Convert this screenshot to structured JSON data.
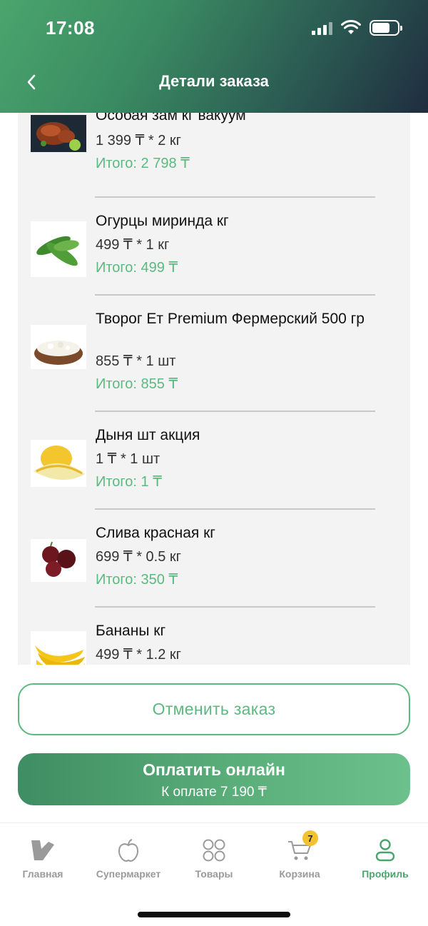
{
  "status_bar": {
    "time": "17:08"
  },
  "header": {
    "title": "Детали заказа"
  },
  "order_items": [
    {
      "name": "Особая зам кг вакуум",
      "qty": "1 399 ₸ * 2 кг",
      "total": "Итого:  2 798 ₸",
      "image": "grilled-chicken"
    },
    {
      "name": "Огурцы миринда кг",
      "qty": "499 ₸ * 1 кг",
      "total": "Итого:  499 ₸",
      "image": "cucumbers"
    },
    {
      "name": "Творог Ет Premium Фермерский 500 гр",
      "qty": "855 ₸ * 1 шт",
      "total": "Итого:  855 ₸",
      "image": "cottage-cheese"
    },
    {
      "name": "Дыня шт акция",
      "qty": "1 ₸ * 1 шт",
      "total": "Итого:  1 ₸",
      "image": "melon"
    },
    {
      "name": "Слива красная кг",
      "qty": "699 ₸ * 0.5 кг",
      "total": "Итого:  350 ₸",
      "image": "plums"
    },
    {
      "name": "Бананы кг",
      "qty": "499 ₸ * 1.2 кг",
      "image": "bananas"
    }
  ],
  "actions": {
    "cancel_label": "Отменить заказ",
    "pay_label": "Оплатить онлайн",
    "pay_amount": "К оплате 7 190 ₸"
  },
  "bottom_nav": {
    "items": [
      {
        "label": "Главная",
        "icon": "home-logo-icon"
      },
      {
        "label": "Супермаркет",
        "icon": "apple-icon"
      },
      {
        "label": "Товары",
        "icon": "grid-icon"
      },
      {
        "label": "Корзина",
        "icon": "cart-icon",
        "badge": "7"
      },
      {
        "label": "Профиль",
        "icon": "profile-icon",
        "active": true
      }
    ]
  },
  "colors": {
    "accent": "#5cb97f",
    "header_start": "#4aa56c",
    "header_end": "#1f2d3f",
    "badge": "#f2c230"
  }
}
